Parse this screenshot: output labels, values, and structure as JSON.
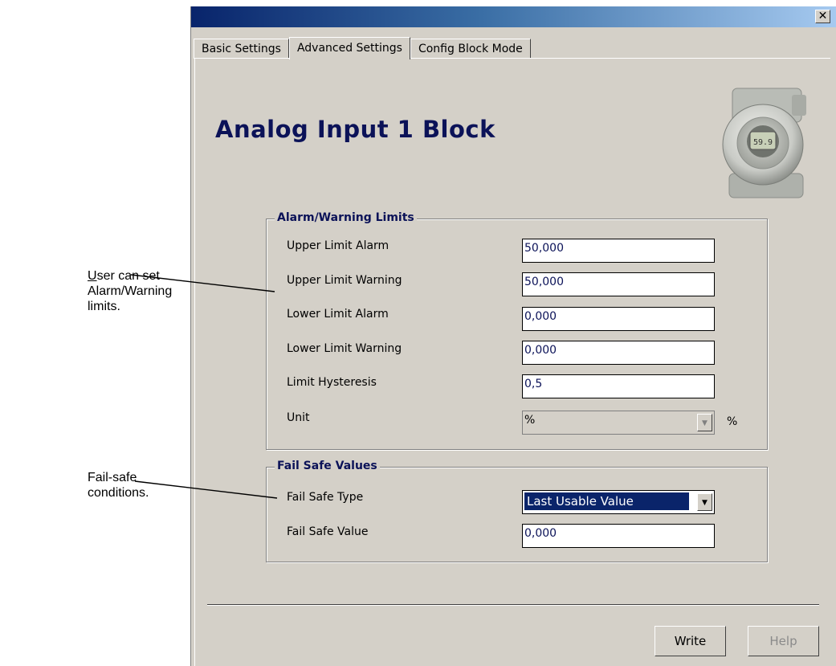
{
  "annotations": {
    "alarm_note": {
      "underlined_letter": "U",
      "line1_rest": "ser can set",
      "line2": "Alarm/Warning",
      "line3": "limits."
    },
    "failsafe_note": {
      "line1": "Fail-safe",
      "line2": "conditions."
    }
  },
  "window": {
    "close_label": "✕"
  },
  "tabs": [
    {
      "label": "Basic Settings",
      "active": false
    },
    {
      "label": "Advanced Settings",
      "active": true
    },
    {
      "label": "Config Block Mode",
      "active": false
    }
  ],
  "block_title": "Analog Input 1 Block",
  "device_display_text": "59.9",
  "alarm_group": {
    "legend": "Alarm/Warning Limits",
    "upper_limit_alarm": {
      "label": "Upper Limit Alarm",
      "value": "50,000"
    },
    "upper_limit_warning": {
      "label": "Upper Limit Warning",
      "value": "50,000"
    },
    "lower_limit_alarm": {
      "label": "Lower Limit Alarm",
      "value": "0,000"
    },
    "lower_limit_warning": {
      "label": "Lower Limit Warning",
      "value": "0,000"
    },
    "limit_hysteresis": {
      "label": "Limit Hysteresis",
      "value": "0,5"
    },
    "unit": {
      "label": "Unit",
      "value": "%",
      "suffix": "%"
    }
  },
  "failsafe_group": {
    "legend": "Fail Safe Values",
    "type": {
      "label": "Fail Safe Type",
      "value": "Last Usable Value"
    },
    "value": {
      "label": "Fail Safe Value",
      "value": "0,000"
    }
  },
  "buttons": {
    "write": "Write",
    "help": "Help"
  },
  "colors": {
    "title_text": "#0b1258",
    "window_bg": "#d4d0c8",
    "selection": "#0a246a"
  }
}
